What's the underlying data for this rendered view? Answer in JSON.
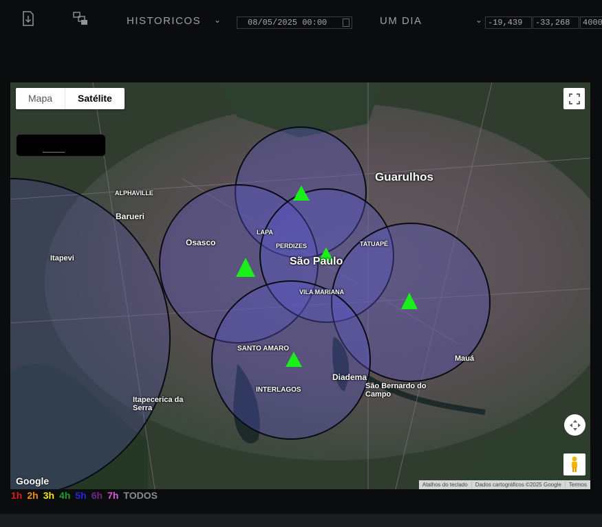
{
  "toolbar": {
    "download_icon": "download-icon",
    "layers_icon": "layers-icon",
    "mode_label": "HISTORICOS",
    "date_value": "08/05/2025 00:00",
    "period_label": "UM DIA",
    "lat_value": "-19,439",
    "lon_value": "-33,268",
    "radius_value": "4000"
  },
  "map": {
    "type_tabs": [
      "Mapa",
      "Satélite"
    ],
    "active_tab": "Satélite",
    "legend_text": "_____",
    "cities": {
      "guarulhos": "Guarulhos",
      "sao_paulo": "São Paulo",
      "osasco": "Osasco",
      "barueri": "Barueri",
      "diadema": "Diadema",
      "maua": "Mauá",
      "interlagos": "INTERLAGOS",
      "santo_amaro": "SANTO AMARO",
      "sbc": "São Bernardo do Campo",
      "itapecerica": "Itapecerica da Serra",
      "itapevi": "Itapevi",
      "lapa": "LAPA",
      "tatuape": "TATUAPÉ",
      "vila_mariana": "VILA MARIANA",
      "perdizes": "PERDIZES",
      "alphaville": "ALPHAVILLE"
    },
    "google_label": "Google",
    "attribution": [
      "Atalhos do teclado",
      "Dados cartográficos ©2025 Google",
      "Termos"
    ],
    "colors": {
      "triangle": "#19f019",
      "circle_fill": "#5a55c8",
      "circle_stroke": "#0a0a14"
    }
  },
  "hour_filters": [
    {
      "label": "1h",
      "color": "#e01b1b"
    },
    {
      "label": "2h",
      "color": "#f08a1c"
    },
    {
      "label": "3h",
      "color": "#f2e41a"
    },
    {
      "label": "4h",
      "color": "#1f9d2a"
    },
    {
      "label": "5h",
      "color": "#2525e0"
    },
    {
      "label": "6h",
      "color": "#6a2a8a"
    },
    {
      "label": "7h",
      "color": "#d85ad8"
    },
    {
      "label": "TODOS",
      "color": "#8a8d90"
    }
  ]
}
